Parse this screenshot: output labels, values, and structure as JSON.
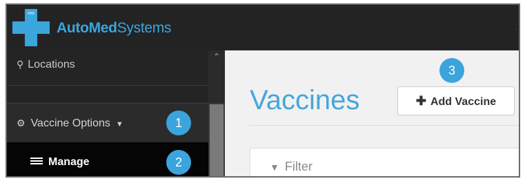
{
  "header": {
    "brand_part1": "AutoMed",
    "brand_part2": "Systems"
  },
  "sidebar": {
    "locations_label": "Locations",
    "vaccine_options_label": "Vaccine Options",
    "manage_label": "Manage"
  },
  "main": {
    "page_title": "Vaccines",
    "add_button_label": "Add Vaccine",
    "filter_placeholder": "Filter"
  },
  "callouts": {
    "one": "1",
    "two": "2",
    "three": "3"
  },
  "icons": {
    "logo": "medical-cross-icon",
    "locations": "map-marker-icon",
    "vaccine_options": "gear-icon",
    "dropdown": "caret-down-icon",
    "manage": "list-icon",
    "add": "plus-icon",
    "filter": "filter-icon",
    "scroll_up": "chevron-up-icon"
  },
  "colors": {
    "accent": "#3ba4dc",
    "topbar": "#232323",
    "sidebar": "#2b2b2b",
    "active_item": "#050505",
    "main_bg": "#f1f1f1"
  }
}
